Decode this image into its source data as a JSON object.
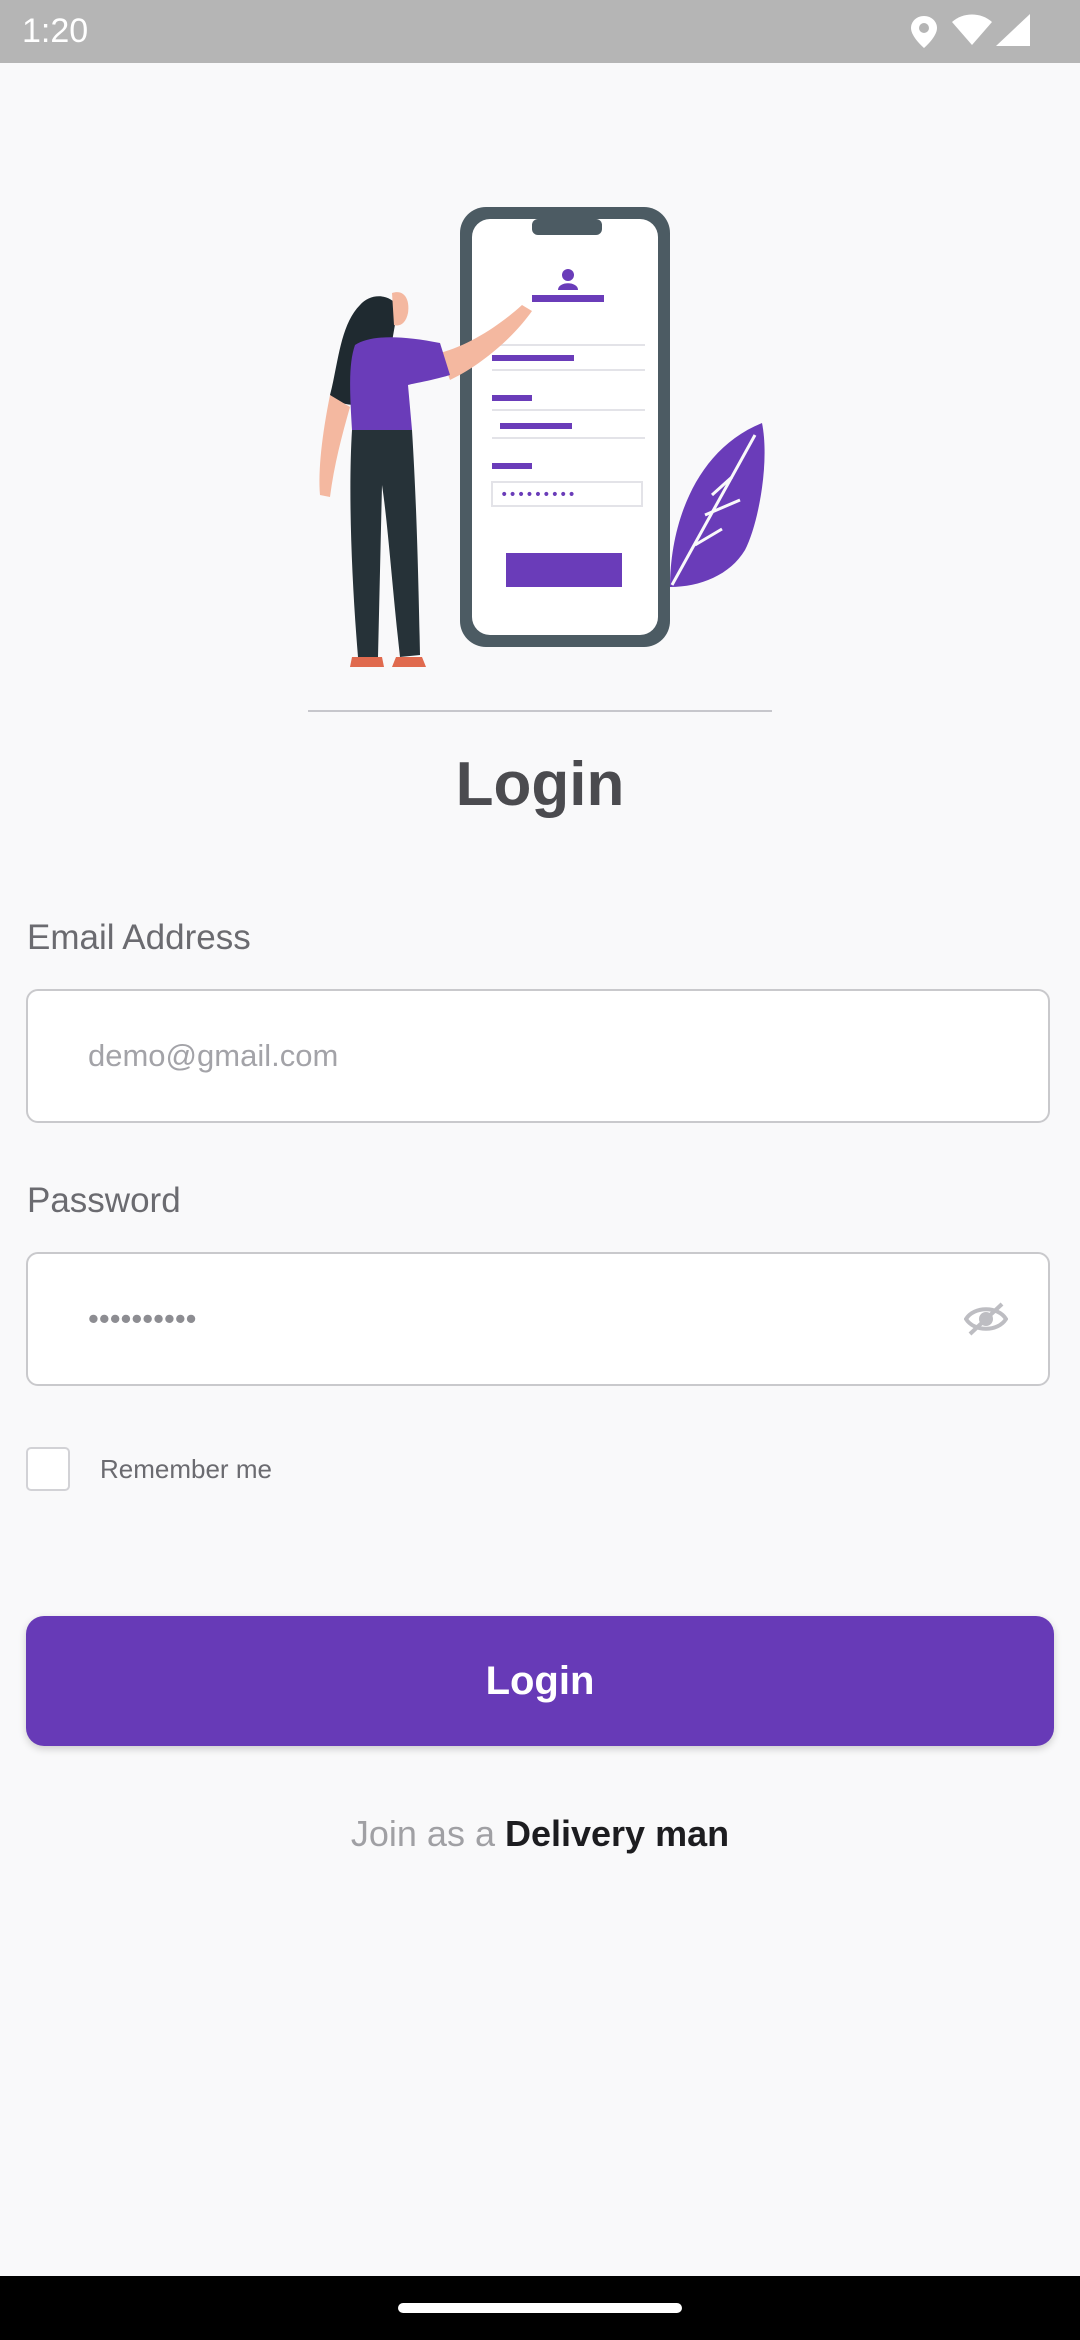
{
  "status_bar": {
    "time": "1:20",
    "icons": [
      "location-icon",
      "wifi-icon",
      "signal-icon"
    ]
  },
  "illustration": {
    "name": "woman-filling-phone-form-illustration",
    "masked_text": "•••••••••"
  },
  "page": {
    "title": "Login"
  },
  "form": {
    "email": {
      "label": "Email Address",
      "placeholder": "demo@gmail.com",
      "value": ""
    },
    "password": {
      "label": "Password",
      "value": "••••••••••",
      "toggle_icon": "eye-off-icon"
    },
    "remember_me": {
      "label": "Remember me",
      "checked": false
    },
    "submit_label": "Login"
  },
  "join": {
    "prefix": "Join as a ",
    "link_label": "Delivery man"
  },
  "colors": {
    "accent": "#673ab7",
    "background": "#f9f9fa",
    "status_bar": "#b5b5b5",
    "title_text": "#4b4b4f"
  }
}
